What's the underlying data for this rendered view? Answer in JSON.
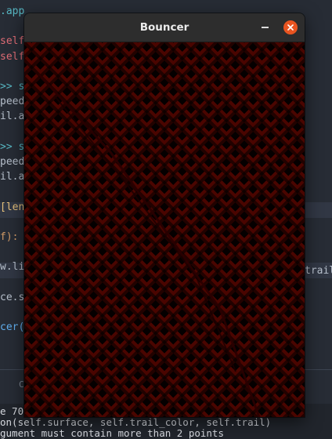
{
  "editor": {
    "lines": [
      {
        "a": ".app",
        "ac": "c-cyan"
      },
      {
        "a": "",
        "ac": ""
      },
      {
        "a": "self.",
        "ac": "c-red"
      },
      {
        "a": "self.",
        "ac": "c-red"
      },
      {
        "a": "",
        "ac": ""
      },
      {
        "a": ">> s",
        "ac": "c-cyan"
      },
      {
        "a": "peed",
        "ac": ""
      },
      {
        "a": "il.a",
        "ac": ""
      },
      {
        "a": "",
        "ac": ""
      },
      {
        "a": ">> s",
        "ac": "c-cyan"
      },
      {
        "a": "peed",
        "ac": ""
      },
      {
        "a": "il.a",
        "ac": ""
      },
      {
        "a": "",
        "ac": ""
      },
      {
        "a": "[len",
        "ac": "c-yellow"
      },
      {
        "a": "",
        "ac": ""
      },
      {
        "a": "f):",
        "ac": "c-orange"
      },
      {
        "a": "",
        "ac": ""
      },
      {
        "a": "w.li",
        "ac": ""
      },
      {
        "a": "",
        "ac": ""
      },
      {
        "a": "ce.s",
        "ac": ""
      },
      {
        "a": "",
        "ac": ""
      },
      {
        "a": "cer(",
        "ac": "c-blue"
      }
    ],
    "right_fragment": "trail",
    "panel_tab": "C"
  },
  "terminal": {
    "line1": "e 70",
    "line2": "on(self.surface, self.trail_color, self.trail)",
    "line3": "gument must contain more than 2 points"
  },
  "window": {
    "title": "Bouncer",
    "minimize_icon": "minimize-icon",
    "close_icon": "close-icon",
    "close_color": "#e95420",
    "trail_color": "#4a0500"
  }
}
